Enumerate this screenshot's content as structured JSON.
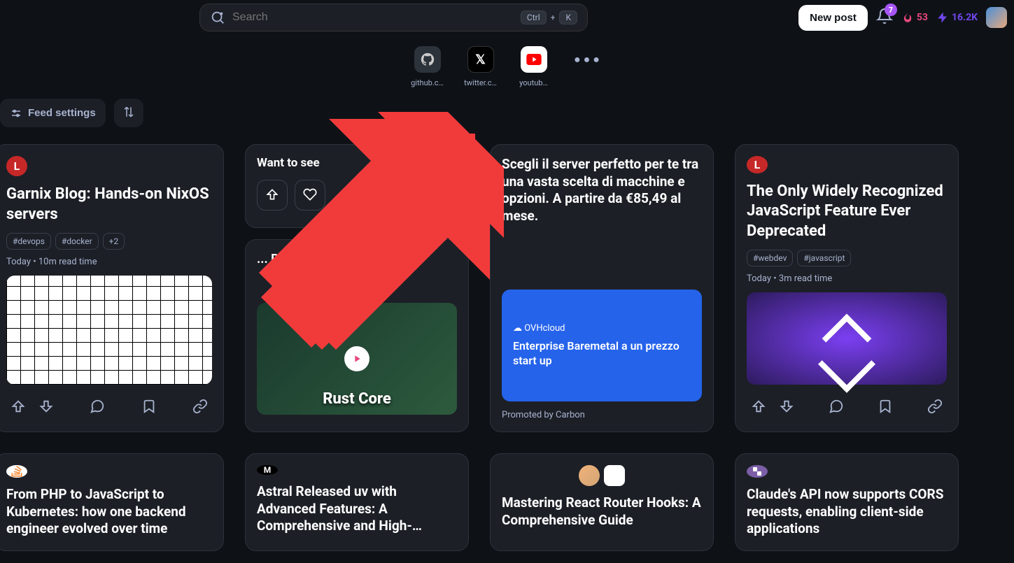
{
  "header": {
    "search_placeholder": "Search",
    "kbd1": "Ctrl",
    "kbd_plus": "+",
    "kbd2": "K",
    "new_post": "New post",
    "notif_count": "7",
    "streak": "53",
    "reputation": "16.2K"
  },
  "shortcuts": [
    {
      "label": "github.c…",
      "icon": "github"
    },
    {
      "label": "twitter.c…",
      "icon": "x"
    },
    {
      "label": "youtub…",
      "icon": "youtube"
    },
    {
      "label": "",
      "icon": "dots"
    }
  ],
  "feed_controls": {
    "settings_label": "Feed settings"
  },
  "cards": [
    {
      "source": "L",
      "title": "Garnix Blog: Hands-on NixOS servers",
      "tags": [
        "#devops",
        "#docker",
        "+2"
      ],
      "meta": "Today • 10m read time"
    },
    {
      "want_title": "Want to see",
      "sub_title": "... Rust As Lay... ..."
    },
    {
      "title": "Scegli il server perfetto per te tra una vasta scelta di macchine e opzioni. A partire da €85,49 al mese.",
      "ad_brand": "OVHcloud",
      "ad_text": "Enterprise Baremetal a un prezzo start up",
      "promo": "Promoted by Carbon"
    },
    {
      "source": "L",
      "title": "The Only Widely Recognized JavaScript Feature Ever Deprecated",
      "tags": [
        "#webdev",
        "#javascript"
      ],
      "meta": "Today • 3m read time"
    }
  ],
  "row2": [
    {
      "source_icon": "so",
      "title": "From PHP to JavaScript to Kubernetes: how one backend engineer evolved over time"
    },
    {
      "source_icon": "m",
      "title": "Astral Released uv with Advanced Features: A Comprehensive and High-…"
    },
    {
      "source_icon": "dual",
      "title": "Mastering React Router Hooks: A Comprehensive Guide"
    },
    {
      "source_icon": "cl",
      "title": "Claude's API now supports CORS requests, enabling client-side applications"
    }
  ]
}
